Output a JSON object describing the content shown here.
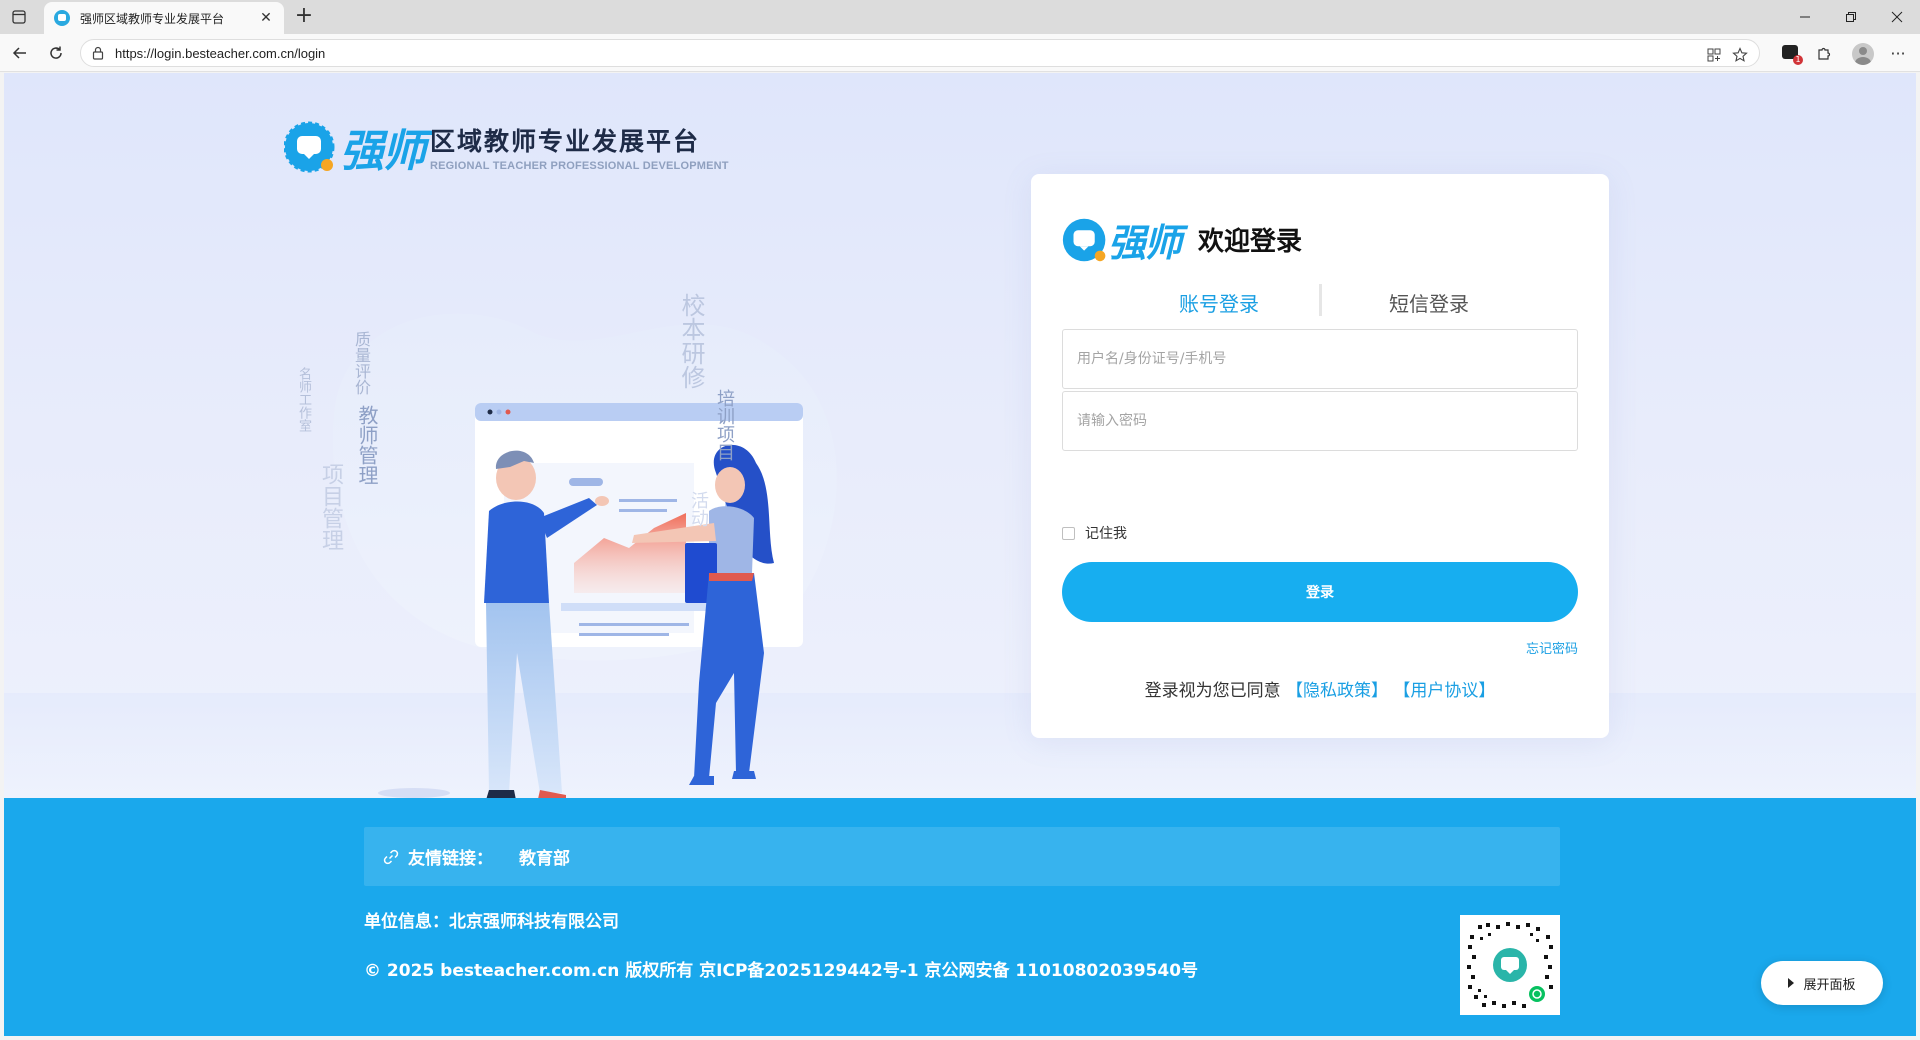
{
  "browser": {
    "tab_title": "强师区域教师专业发展平台",
    "url": "https://login.besteacher.com.cn/login",
    "extension_badge": "1"
  },
  "brand": {
    "word": "强师",
    "name_cn": "区域教师专业发展平台",
    "name_en": "REGIONAL TEACHER PROFESSIONAL DEVELOPMENT",
    "accent": "#1aa3e8"
  },
  "illustration": {
    "tags": [
      "质量评价",
      "名师工作室",
      "教师管理",
      "项目管理",
      "校本研修",
      "培训项目",
      "活动"
    ]
  },
  "login": {
    "brand_word": "强师",
    "title": "欢迎登录",
    "tabs": [
      {
        "label": "账号登录",
        "active": true
      },
      {
        "label": "短信登录",
        "active": false
      }
    ],
    "username_placeholder": "用户名/身份证号/手机号",
    "password_placeholder": "请输入密码",
    "remember_label": "记住我",
    "submit_label": "登录",
    "forgot_label": "忘记密码",
    "agreement_prefix": "登录视为您已同意",
    "privacy_link": "【隐私政策】",
    "terms_link": "【用户协议】"
  },
  "footer": {
    "links_label": "友情链接：",
    "links": [
      "教育部"
    ],
    "unit_info": "单位信息：北京强师科技有限公司",
    "copyright": "© 2025 besteacher.com.cn 版权所有 京ICP备2025129442号-1  京公网安备 11010802039540号",
    "background": "#1aa8ec"
  },
  "expand_panel_label": "展开面板"
}
